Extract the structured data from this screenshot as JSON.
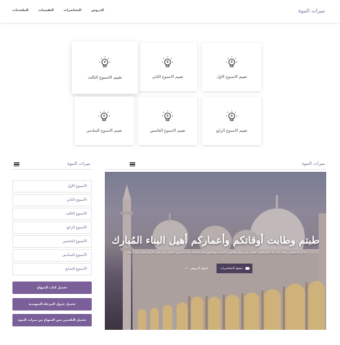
{
  "nav": {
    "brand": "ميراث النبوة",
    "links": [
      "الدروس",
      "المحاضرات",
      "التقييمات",
      "الملخصات"
    ]
  },
  "cards": [
    "تقييم الاسبوع الاول",
    "تقييم الاسبوع الثاني",
    "تقييم الاسبوع الثالث",
    "تقييم الاسبوع الرابع",
    "تقييم الاسبوع الخامس",
    "تقييم الاسبوع السادس"
  ],
  "sidebar": {
    "title": "ميراث النبوة",
    "weeks": [
      "الأسبوع الأول",
      "الأسبوع الثاني",
      "الأسبوع الثالث",
      "الأسبوع الرابع",
      "الأسبوع الخامس",
      "الأسبوع السادس",
      "الأسبوع السابع"
    ],
    "buttons": [
      "تحميل كتاب المنهاج",
      "تحميل جدول المرحلة التمهيدية",
      "تحميل التلخيص متن المنهاج من ميراث النبوة"
    ]
  },
  "main": {
    "title": "ميراث النبوة",
    "hero_title": "طبتم وطابت أوقاتكم وأعماركم أهيل البناء المُبارك",
    "hero_subtitle": "قال الأعمش رحمه الله: لا أعلم قوماً أفضل من قوم يطلبون الحديث ويحبون هذه السُنّة، كم أنتم في الناس في أهل الأرض قليل من الذهب",
    "btn_lectures": "تصفح المحاضرات",
    "btn_lessons": "تصفح الدروس"
  },
  "colors": {
    "accent": "#7a5f98",
    "brand_text": "#7b6a99"
  }
}
